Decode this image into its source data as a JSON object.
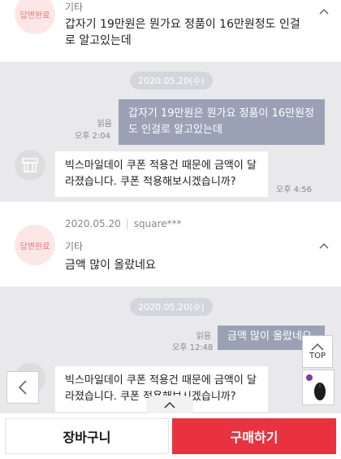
{
  "qa1": {
    "badge": "답변완료",
    "category": "기타",
    "question": "갑자기 19만원은 뭔가요 정품이 16만원정도 인걸로 알고있는데"
  },
  "conv1": {
    "date": "2020.05.20(수)",
    "read_label": "읽음",
    "user_time": "오후 2:04",
    "user_message": "갑자기 19만원은 뭔가요 정품이 16만원정도 인걸로 알고있는데",
    "bot_message": "빅스마일데이 쿠폰 적용건 때문에 금액이 달라졌습니다. 쿠폰 적용해보시겠습니까?",
    "bot_time": "오후 4:56"
  },
  "qa2": {
    "date": "2020.05.20",
    "author": "square***",
    "badge": "답변완료",
    "category": "기타",
    "question": "금액 많이 올랐네요"
  },
  "conv2": {
    "date": "2020.05.20(수)",
    "read_label": "읽음",
    "user_time": "오후 12:48",
    "user_message": "금액 많이 올랐네요",
    "bot_message": "빅스마일데이 쿠폰 적용건 때문에 금액이 달라졌습니다. 쿠폰 적용해보시겠습니까?"
  },
  "floating": {
    "top_label": "TOP"
  },
  "bottom": {
    "cart_label": "장바구니",
    "buy_label": "구매하기"
  }
}
